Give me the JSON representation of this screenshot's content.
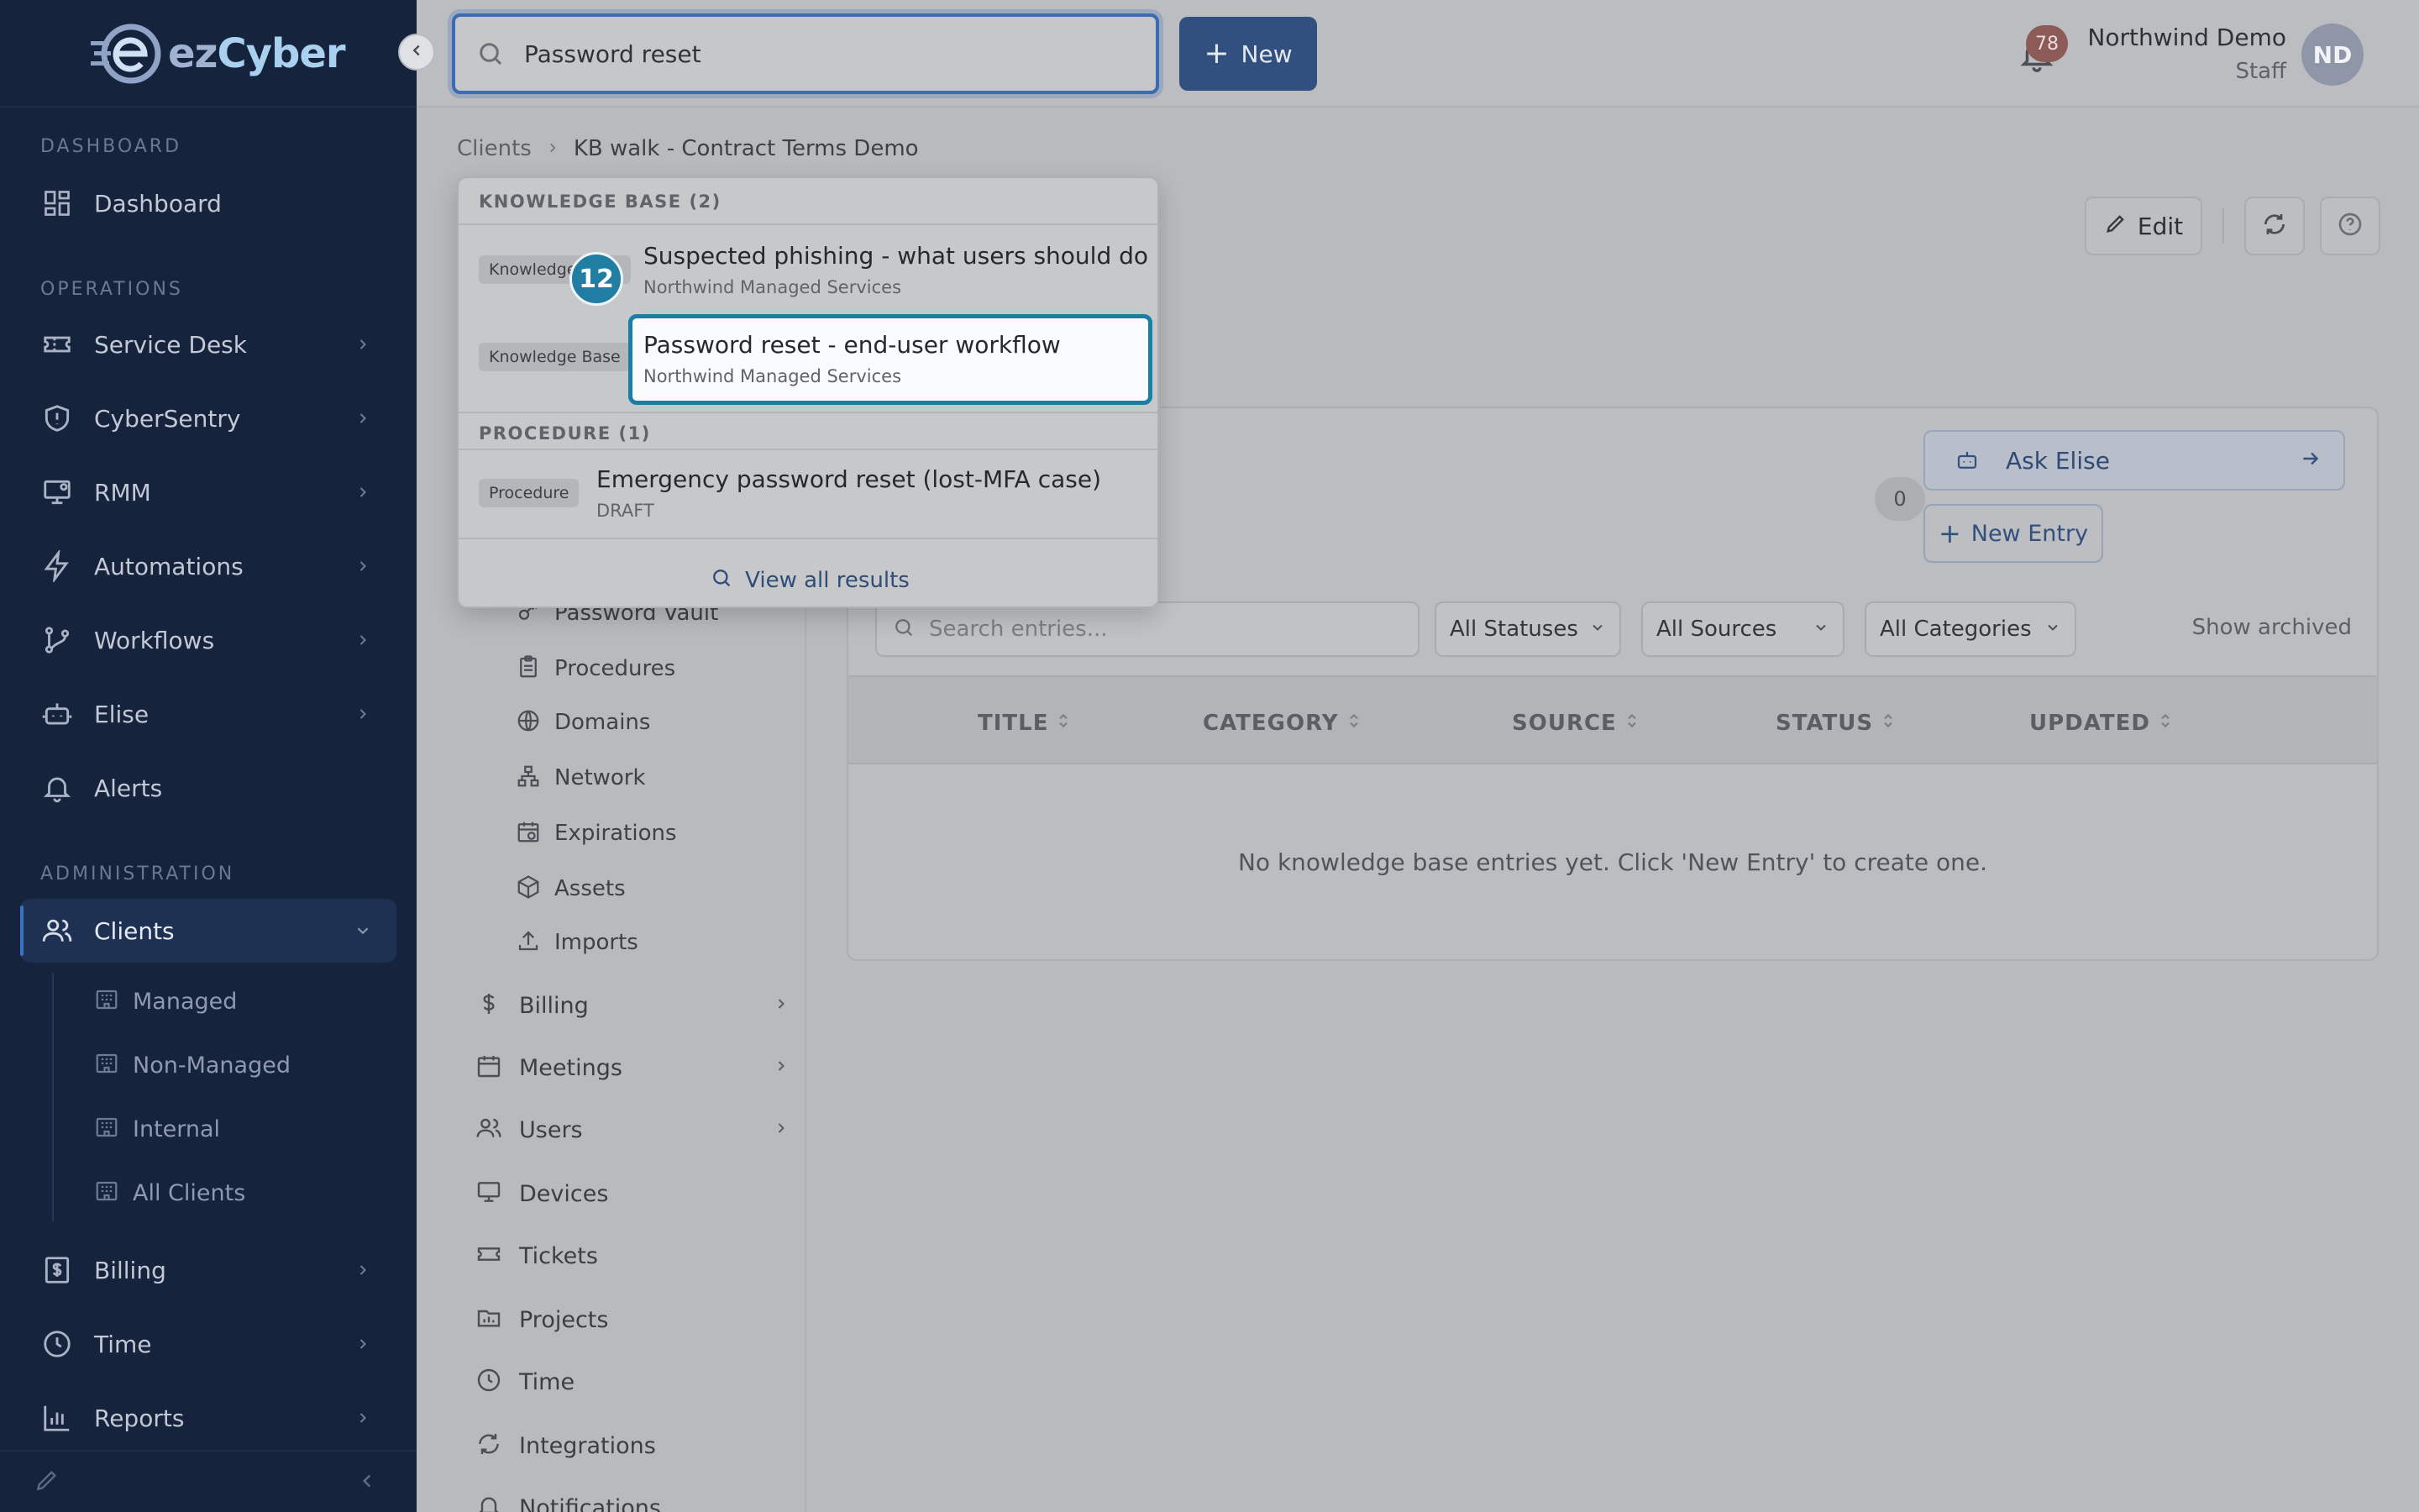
{
  "app": {
    "logo_text_a": "ez",
    "logo_text_b": "Cyber"
  },
  "sidebar": {
    "sections": {
      "dashboard": "DASHBOARD",
      "operations": "OPERATIONS",
      "administration": "ADMINISTRATION"
    },
    "items": [
      {
        "label": "Dashboard",
        "icon": "dashboard-icon"
      },
      {
        "label": "Service Desk",
        "icon": "ticket-icon"
      },
      {
        "label": "CyberSentry",
        "icon": "shield-icon"
      },
      {
        "label": "RMM",
        "icon": "monitor-icon"
      },
      {
        "label": "Automations",
        "icon": "bolt-icon"
      },
      {
        "label": "Workflows",
        "icon": "workflow-icon"
      },
      {
        "label": "Elise",
        "icon": "robot-icon"
      },
      {
        "label": "Alerts",
        "icon": "bell-icon"
      },
      {
        "label": "Clients",
        "icon": "users-icon"
      },
      {
        "label": "Billing",
        "icon": "billing-icon"
      },
      {
        "label": "Time",
        "icon": "clock-icon"
      },
      {
        "label": "Reports",
        "icon": "chart-icon"
      }
    ],
    "client_sub": [
      "Managed",
      "Non-Managed",
      "Internal",
      "All Clients"
    ]
  },
  "topbar": {
    "search_value": "Password reset",
    "new_label": "New",
    "notification_count": "78",
    "user_name": "Northwind Demo",
    "user_role": "Staff",
    "avatar_initials": "ND"
  },
  "breadcrumb": {
    "root": "Clients",
    "current": "KB walk - Contract Terms Demo"
  },
  "header": {
    "edit_label": "Edit"
  },
  "subnav": {
    "sub_items": [
      "Password Vault",
      "Procedures",
      "Domains",
      "Network",
      "Expirations",
      "Assets",
      "Imports"
    ],
    "items": [
      {
        "label": "Billing",
        "chevron": true
      },
      {
        "label": "Meetings",
        "chevron": true
      },
      {
        "label": "Users",
        "chevron": true
      },
      {
        "label": "Devices",
        "chevron": false
      },
      {
        "label": "Tickets",
        "chevron": false
      },
      {
        "label": "Projects",
        "chevron": false
      },
      {
        "label": "Time",
        "chevron": false
      },
      {
        "label": "Integrations",
        "chevron": false
      },
      {
        "label": "Notifications",
        "chevron": false
      }
    ]
  },
  "kb": {
    "count": "0",
    "ask_elise": "Ask Elise",
    "new_entry": "New Entry",
    "search_placeholder": "Search entries...",
    "filters": {
      "status": "All Statuses",
      "source": "All Sources",
      "category": "All Categories"
    },
    "show_archived": "Show archived",
    "columns": [
      "TITLE",
      "CATEGORY",
      "SOURCE",
      "STATUS",
      "UPDATED"
    ],
    "empty_message": "No knowledge base entries yet. Click 'New Entry' to create one."
  },
  "dropdown": {
    "group_kb": "KNOWLEDGE BASE (2)",
    "group_proc": "PROCEDURE (1)",
    "results": [
      {
        "tag": "Knowledge Base",
        "title": "Suspected phishing - what users should do",
        "subtitle": "Northwind Managed Services"
      },
      {
        "tag": "Knowledge Base",
        "title": "Password reset - end-user workflow",
        "subtitle": "Northwind Managed Services"
      },
      {
        "tag": "Procedure",
        "title": "Emergency password reset (lost-MFA case)",
        "subtitle": "DRAFT"
      }
    ],
    "view_all": "View all results",
    "step_badge": "12"
  },
  "colors": {
    "sidebar_bg": "#16233d",
    "accent": "#3b6bb4",
    "highlight": "#1a7fa6"
  }
}
